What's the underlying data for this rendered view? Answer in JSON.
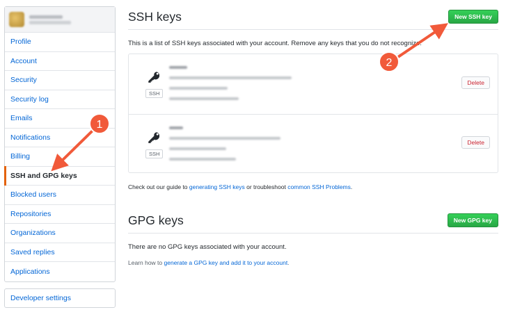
{
  "sidebar": {
    "items": [
      {
        "label": "Profile",
        "selected": false
      },
      {
        "label": "Account",
        "selected": false
      },
      {
        "label": "Security",
        "selected": false
      },
      {
        "label": "Security log",
        "selected": false
      },
      {
        "label": "Emails",
        "selected": false
      },
      {
        "label": "Notifications",
        "selected": false
      },
      {
        "label": "Billing",
        "selected": false
      },
      {
        "label": "SSH and GPG keys",
        "selected": true
      },
      {
        "label": "Blocked users",
        "selected": false
      },
      {
        "label": "Repositories",
        "selected": false
      },
      {
        "label": "Organizations",
        "selected": false
      },
      {
        "label": "Saved replies",
        "selected": false
      },
      {
        "label": "Applications",
        "selected": false
      }
    ],
    "developer_settings": "Developer settings"
  },
  "ssh": {
    "title": "SSH keys",
    "new_button": "New SSH key",
    "intro": "This is a list of SSH keys associated with your account. Remove any keys that you do not recognize.",
    "keys": [
      {
        "type_label": "SSH",
        "delete_label": "Delete"
      },
      {
        "type_label": "SSH",
        "delete_label": "Delete"
      }
    ],
    "guide": {
      "prefix": "Check out our guide to ",
      "link1": "generating SSH keys",
      "middle": " or troubleshoot ",
      "link2": "common SSH Problems",
      "suffix": "."
    }
  },
  "gpg": {
    "title": "GPG keys",
    "new_button": "New GPG key",
    "empty_text": "There are no GPG keys associated with your account.",
    "learn": {
      "prefix": "Learn how to ",
      "link": "generate a GPG key and add it to your account",
      "suffix": "."
    }
  },
  "annotations": {
    "step1": "1",
    "step2": "2",
    "arrow_color": "#f15a3a"
  },
  "colors": {
    "accent_green": "#28a745",
    "link_blue": "#0366d6",
    "selected_bar": "#e36209",
    "delete_red": "#cb2431"
  }
}
